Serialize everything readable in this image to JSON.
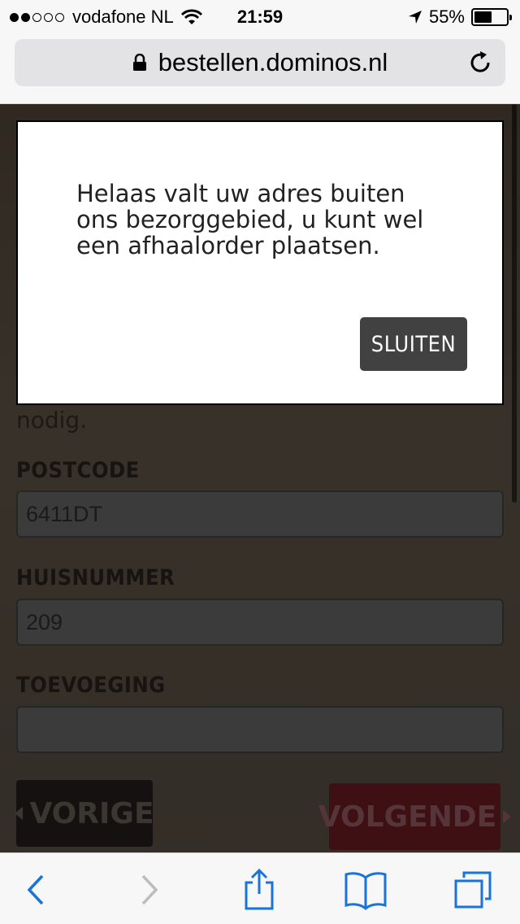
{
  "status_bar": {
    "carrier": "vodafone NL",
    "time": "21:59",
    "battery": "55%",
    "battery_level": 0.55,
    "signal_bars_filled": 2,
    "signal_bars_total": 5
  },
  "browser": {
    "url": "bestellen.dominos.nl",
    "lock_icon": "lock-icon",
    "reload_icon": "reload-icon"
  },
  "page": {
    "partial_text": "nodig.",
    "fields": [
      {
        "label": "POSTCODE",
        "value": "6411DT"
      },
      {
        "label": "HUISNUMMER",
        "value": "209"
      },
      {
        "label": "TOEVOEGING",
        "value": ""
      }
    ],
    "prev_label": "VORIGE",
    "next_label": "VOLGENDE"
  },
  "modal": {
    "message": "Helaas valt uw adres buiten ons bezorggebied, u kunt wel een afhaalorder plaatsen.",
    "close_label": "SLUITEN"
  },
  "toolbar": {
    "icons": [
      "back-icon",
      "forward-icon",
      "share-icon",
      "bookmarks-icon",
      "tabs-icon"
    ],
    "accent": "#1a73d9"
  }
}
